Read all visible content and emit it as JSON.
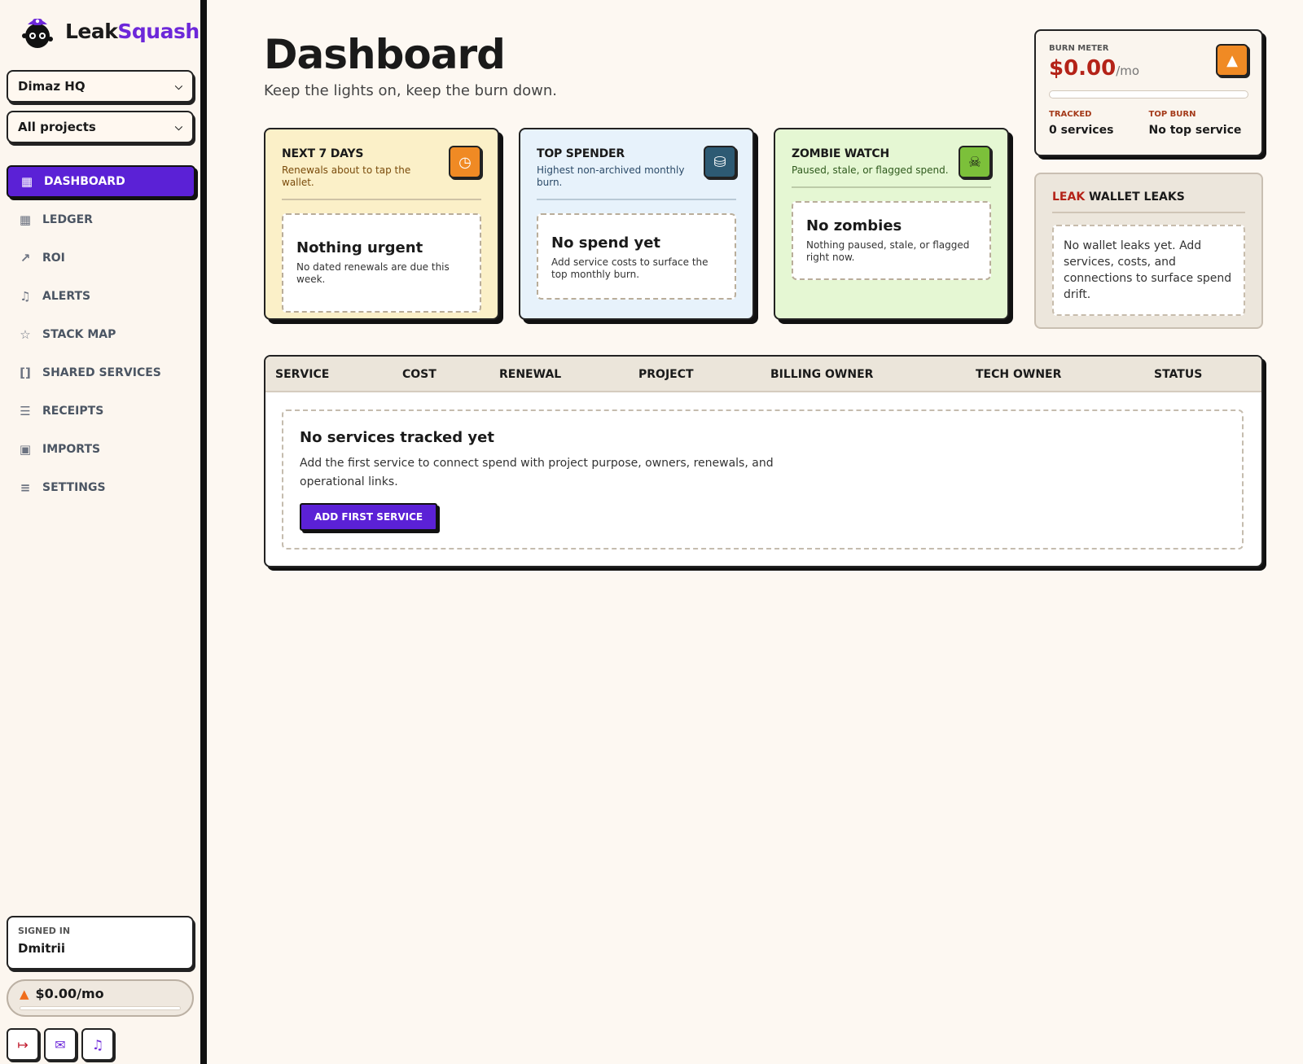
{
  "brand": {
    "part1": "Leak",
    "part2": "Squash"
  },
  "workspace_select": {
    "value": "Dimaz HQ"
  },
  "project_select": {
    "value": "All projects"
  },
  "nav": {
    "items": [
      {
        "label": "DASHBOARD",
        "icon": "grid-icon",
        "active": true
      },
      {
        "label": "LEDGER",
        "icon": "table-icon"
      },
      {
        "label": "ROI",
        "icon": "trending-up-icon"
      },
      {
        "label": "ALERTS",
        "icon": "bell-icon"
      },
      {
        "label": "STACK MAP",
        "icon": "network-icon"
      },
      {
        "label": "SHARED SERVICES",
        "icon": "brackets-icon"
      },
      {
        "label": "RECEIPTS",
        "icon": "receipt-icon"
      },
      {
        "label": "IMPORTS",
        "icon": "robot-icon"
      },
      {
        "label": "SETTINGS",
        "icon": "sliders-icon"
      }
    ]
  },
  "signed_in": {
    "label": "SIGNED IN",
    "name": "Dmitrii"
  },
  "burn_pill": {
    "amount": "$0.00/mo"
  },
  "page": {
    "title": "Dashboard",
    "subtitle": "Keep the lights on, keep the burn down."
  },
  "cards": {
    "next7": {
      "header": "NEXT 7 DAYS",
      "sub": "Renewals about to tap the wallet.",
      "empty_title": "Nothing urgent",
      "empty_desc": "No dated renewals are due this week."
    },
    "top_spender": {
      "header": "TOP SPENDER",
      "sub": "Highest non-archived monthly burn.",
      "empty_title": "No spend yet",
      "empty_desc": "Add service costs to surface the top monthly burn."
    },
    "zombie": {
      "header": "ZOMBIE WATCH",
      "sub": "Paused, stale, or flagged spend.",
      "empty_title": "No zombies",
      "empty_desc": "Nothing paused, stale, or flagged right now."
    }
  },
  "burn_meter": {
    "label": "BURN METER",
    "amount": "$0.00",
    "per": "/mo",
    "progress": 0,
    "tracked_label": "TRACKED",
    "tracked_value": "0 services",
    "top_burn_label": "TOP BURN",
    "top_burn_value": "No top service"
  },
  "leaks": {
    "title_red": "LEAK",
    "title": "WALLET LEAKS",
    "message": "No wallet leaks yet. Add services, costs, and connections to surface spend drift."
  },
  "table": {
    "columns": [
      "SERVICE",
      "COST",
      "RENEWAL",
      "PROJECT",
      "BILLING OWNER",
      "TECH OWNER",
      "STATUS"
    ],
    "empty_title": "No services tracked yet",
    "empty_desc": "Add the first service to connect spend with project purpose, owners, renewals, and operational links.",
    "cta": "ADD FIRST SERVICE"
  },
  "colors": {
    "accent": "#5b21d6",
    "burn_red": "#b42318",
    "flame": "#f08a24"
  }
}
